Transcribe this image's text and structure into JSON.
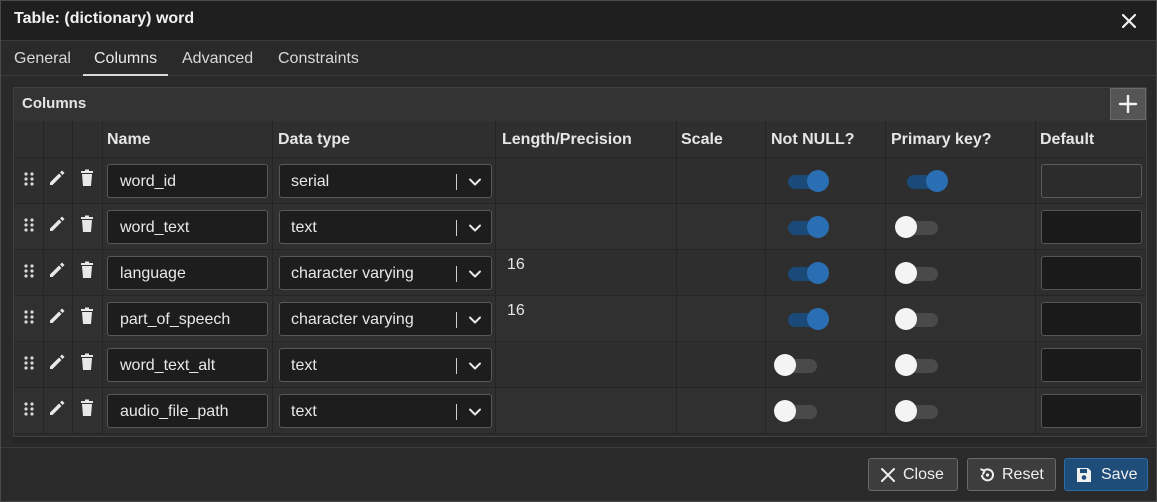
{
  "dialog": {
    "title": "Table: (dictionary) word",
    "close_icon": "close-icon"
  },
  "tabs": [
    {
      "label": "General",
      "active": false
    },
    {
      "label": "Columns",
      "active": true
    },
    {
      "label": "Advanced",
      "active": false
    },
    {
      "label": "Constraints",
      "active": false
    }
  ],
  "panel": {
    "title": "Columns",
    "add_icon": "plus-icon"
  },
  "columns_header": {
    "name": "Name",
    "data_type": "Data type",
    "length": "Length/Precision",
    "scale": "Scale",
    "not_null": "Not NULL?",
    "primary_key": "Primary key?",
    "default": "Default"
  },
  "rows": [
    {
      "name": "word_id",
      "data_type": "serial",
      "length": "",
      "scale": "",
      "not_null": true,
      "primary_key": true,
      "default": ""
    },
    {
      "name": "word_text",
      "data_type": "text",
      "length": "",
      "scale": "",
      "not_null": true,
      "primary_key": false,
      "default": ""
    },
    {
      "name": "language",
      "data_type": "character varying",
      "length": "16",
      "scale": "",
      "not_null": true,
      "primary_key": false,
      "default": ""
    },
    {
      "name": "part_of_speech",
      "data_type": "character varying",
      "length": "16",
      "scale": "",
      "not_null": true,
      "primary_key": false,
      "default": ""
    },
    {
      "name": "word_text_alt",
      "data_type": "text",
      "length": "",
      "scale": "",
      "not_null": false,
      "primary_key": false,
      "default": ""
    },
    {
      "name": "audio_file_path",
      "data_type": "text",
      "length": "",
      "scale": "",
      "not_null": false,
      "primary_key": false,
      "default": ""
    }
  ],
  "footer": {
    "close_label": "Close",
    "reset_label": "Reset",
    "save_label": "Save"
  },
  "colors": {
    "accent": "#2a6fb3",
    "save_button": "#1e4d7a",
    "background": "#2a2a2a"
  }
}
